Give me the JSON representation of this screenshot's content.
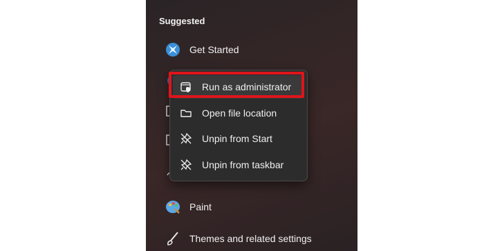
{
  "start_menu": {
    "section_title": "Suggested",
    "apps": [
      {
        "label": "Get Started",
        "icon": "get-started-icon"
      },
      {
        "label": "Paint",
        "icon": "paint-palette-icon"
      },
      {
        "label": "Themes and related settings",
        "icon": "brush-icon"
      }
    ]
  },
  "context_menu": {
    "items": [
      {
        "label": "Run as administrator",
        "icon": "shield-window-icon"
      },
      {
        "label": "Open file location",
        "icon": "folder-icon"
      },
      {
        "label": "Unpin from Start",
        "icon": "unpin-icon"
      },
      {
        "label": "Unpin from taskbar",
        "icon": "unpin-icon"
      }
    ]
  },
  "colors": {
    "panel_bg": "#2a2426",
    "menu_bg": "#2c2c2c",
    "highlight": "#e0141b",
    "text": "#f0f0f0"
  }
}
